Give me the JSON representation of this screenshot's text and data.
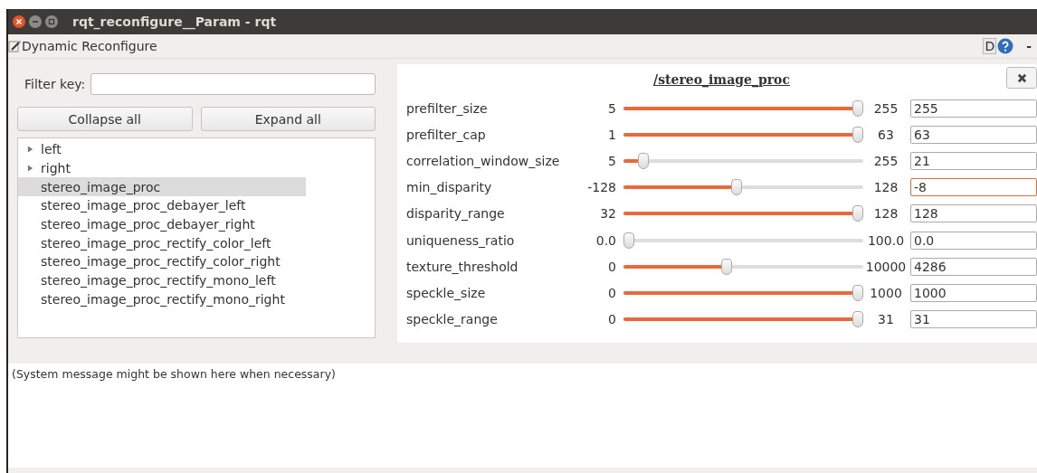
{
  "window": {
    "title": "rqt_reconfigure__Param - rqt"
  },
  "plugin": {
    "title": "Dynamic Reconfigure",
    "d_label": "D",
    "minimize": "-"
  },
  "filter": {
    "label": "Filter key:"
  },
  "buttons": [
    "Collapse all",
    "Expand all"
  ],
  "tree": [
    {
      "label": "left",
      "expandable": true,
      "selected": false
    },
    {
      "label": "right",
      "expandable": true,
      "selected": false
    },
    {
      "label": "stereo_image_proc",
      "expandable": false,
      "selected": true
    },
    {
      "label": "stereo_image_proc_debayer_left",
      "expandable": false,
      "selected": false
    },
    {
      "label": "stereo_image_proc_debayer_right",
      "expandable": false,
      "selected": false
    },
    {
      "label": "stereo_image_proc_rectify_color_left",
      "expandable": false,
      "selected": false
    },
    {
      "label": "stereo_image_proc_rectify_color_right",
      "expandable": false,
      "selected": false
    },
    {
      "label": "stereo_image_proc_rectify_mono_left",
      "expandable": false,
      "selected": false
    },
    {
      "label": "stereo_image_proc_rectify_mono_right",
      "expandable": false,
      "selected": false
    }
  ],
  "node_panel": {
    "title": "/stereo_image_proc",
    "params": [
      {
        "name": "prefilter_size",
        "min": "5",
        "max": "255",
        "level": 1.0,
        "value": "255",
        "focused": false
      },
      {
        "name": "prefilter_cap",
        "min": "1",
        "max": "63",
        "level": 1.0,
        "value": "63",
        "focused": false
      },
      {
        "name": "correlation_window_size",
        "min": "5",
        "max": "255",
        "level": 0.064,
        "value": "21",
        "focused": false
      },
      {
        "name": "min_disparity",
        "min": "-128",
        "max": "128",
        "level": 0.47,
        "value": "-8",
        "focused": true
      },
      {
        "name": "disparity_range",
        "min": "32",
        "max": "128",
        "level": 1.0,
        "value": "128",
        "focused": false
      },
      {
        "name": "uniqueness_ratio",
        "min": "0.0",
        "max": "100.0",
        "level": 0.0,
        "value": "0.0",
        "focused": false
      },
      {
        "name": "texture_threshold",
        "min": "0",
        "max": "10000",
        "level": 0.4286,
        "value": "4286",
        "focused": false
      },
      {
        "name": "speckle_size",
        "min": "0",
        "max": "1000",
        "level": 1.0,
        "value": "1000",
        "focused": false
      },
      {
        "name": "speckle_range",
        "min": "0",
        "max": "31",
        "level": 1.0,
        "value": "31",
        "focused": false
      }
    ]
  },
  "status": {
    "message": "(System message might be shown here when necessary)"
  }
}
